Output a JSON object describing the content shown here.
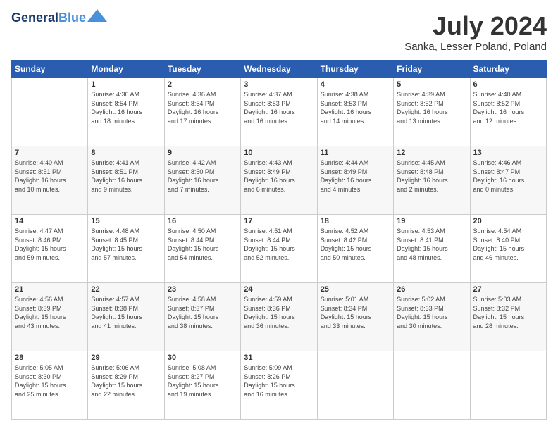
{
  "logo": {
    "line1": "General",
    "line2": "Blue"
  },
  "title": "July 2024",
  "location": "Sanka, Lesser Poland, Poland",
  "days_of_week": [
    "Sunday",
    "Monday",
    "Tuesday",
    "Wednesday",
    "Thursday",
    "Friday",
    "Saturday"
  ],
  "weeks": [
    [
      {
        "day": "",
        "text": ""
      },
      {
        "day": "1",
        "text": "Sunrise: 4:36 AM\nSunset: 8:54 PM\nDaylight: 16 hours\nand 18 minutes."
      },
      {
        "day": "2",
        "text": "Sunrise: 4:36 AM\nSunset: 8:54 PM\nDaylight: 16 hours\nand 17 minutes."
      },
      {
        "day": "3",
        "text": "Sunrise: 4:37 AM\nSunset: 8:53 PM\nDaylight: 16 hours\nand 16 minutes."
      },
      {
        "day": "4",
        "text": "Sunrise: 4:38 AM\nSunset: 8:53 PM\nDaylight: 16 hours\nand 14 minutes."
      },
      {
        "day": "5",
        "text": "Sunrise: 4:39 AM\nSunset: 8:52 PM\nDaylight: 16 hours\nand 13 minutes."
      },
      {
        "day": "6",
        "text": "Sunrise: 4:40 AM\nSunset: 8:52 PM\nDaylight: 16 hours\nand 12 minutes."
      }
    ],
    [
      {
        "day": "7",
        "text": "Sunrise: 4:40 AM\nSunset: 8:51 PM\nDaylight: 16 hours\nand 10 minutes."
      },
      {
        "day": "8",
        "text": "Sunrise: 4:41 AM\nSunset: 8:51 PM\nDaylight: 16 hours\nand 9 minutes."
      },
      {
        "day": "9",
        "text": "Sunrise: 4:42 AM\nSunset: 8:50 PM\nDaylight: 16 hours\nand 7 minutes."
      },
      {
        "day": "10",
        "text": "Sunrise: 4:43 AM\nSunset: 8:49 PM\nDaylight: 16 hours\nand 6 minutes."
      },
      {
        "day": "11",
        "text": "Sunrise: 4:44 AM\nSunset: 8:49 PM\nDaylight: 16 hours\nand 4 minutes."
      },
      {
        "day": "12",
        "text": "Sunrise: 4:45 AM\nSunset: 8:48 PM\nDaylight: 16 hours\nand 2 minutes."
      },
      {
        "day": "13",
        "text": "Sunrise: 4:46 AM\nSunset: 8:47 PM\nDaylight: 16 hours\nand 0 minutes."
      }
    ],
    [
      {
        "day": "14",
        "text": "Sunrise: 4:47 AM\nSunset: 8:46 PM\nDaylight: 15 hours\nand 59 minutes."
      },
      {
        "day": "15",
        "text": "Sunrise: 4:48 AM\nSunset: 8:45 PM\nDaylight: 15 hours\nand 57 minutes."
      },
      {
        "day": "16",
        "text": "Sunrise: 4:50 AM\nSunset: 8:44 PM\nDaylight: 15 hours\nand 54 minutes."
      },
      {
        "day": "17",
        "text": "Sunrise: 4:51 AM\nSunset: 8:44 PM\nDaylight: 15 hours\nand 52 minutes."
      },
      {
        "day": "18",
        "text": "Sunrise: 4:52 AM\nSunset: 8:42 PM\nDaylight: 15 hours\nand 50 minutes."
      },
      {
        "day": "19",
        "text": "Sunrise: 4:53 AM\nSunset: 8:41 PM\nDaylight: 15 hours\nand 48 minutes."
      },
      {
        "day": "20",
        "text": "Sunrise: 4:54 AM\nSunset: 8:40 PM\nDaylight: 15 hours\nand 46 minutes."
      }
    ],
    [
      {
        "day": "21",
        "text": "Sunrise: 4:56 AM\nSunset: 8:39 PM\nDaylight: 15 hours\nand 43 minutes."
      },
      {
        "day": "22",
        "text": "Sunrise: 4:57 AM\nSunset: 8:38 PM\nDaylight: 15 hours\nand 41 minutes."
      },
      {
        "day": "23",
        "text": "Sunrise: 4:58 AM\nSunset: 8:37 PM\nDaylight: 15 hours\nand 38 minutes."
      },
      {
        "day": "24",
        "text": "Sunrise: 4:59 AM\nSunset: 8:36 PM\nDaylight: 15 hours\nand 36 minutes."
      },
      {
        "day": "25",
        "text": "Sunrise: 5:01 AM\nSunset: 8:34 PM\nDaylight: 15 hours\nand 33 minutes."
      },
      {
        "day": "26",
        "text": "Sunrise: 5:02 AM\nSunset: 8:33 PM\nDaylight: 15 hours\nand 30 minutes."
      },
      {
        "day": "27",
        "text": "Sunrise: 5:03 AM\nSunset: 8:32 PM\nDaylight: 15 hours\nand 28 minutes."
      }
    ],
    [
      {
        "day": "28",
        "text": "Sunrise: 5:05 AM\nSunset: 8:30 PM\nDaylight: 15 hours\nand 25 minutes."
      },
      {
        "day": "29",
        "text": "Sunrise: 5:06 AM\nSunset: 8:29 PM\nDaylight: 15 hours\nand 22 minutes."
      },
      {
        "day": "30",
        "text": "Sunrise: 5:08 AM\nSunset: 8:27 PM\nDaylight: 15 hours\nand 19 minutes."
      },
      {
        "day": "31",
        "text": "Sunrise: 5:09 AM\nSunset: 8:26 PM\nDaylight: 15 hours\nand 16 minutes."
      },
      {
        "day": "",
        "text": ""
      },
      {
        "day": "",
        "text": ""
      },
      {
        "day": "",
        "text": ""
      }
    ]
  ]
}
